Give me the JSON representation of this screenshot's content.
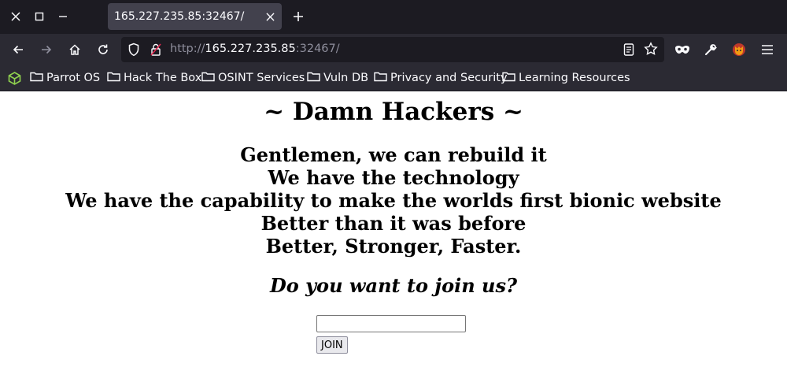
{
  "browser": {
    "tab": {
      "title": "165.227.235.85:32467/"
    },
    "url": {
      "scheme": "http://",
      "host": "165.227.235.85",
      "port": ":32467/"
    },
    "bookmarks": [
      {
        "label": "Parrot OS"
      },
      {
        "label": "Hack The Box"
      },
      {
        "label": "OSINT Services"
      },
      {
        "label": "Vuln DB"
      },
      {
        "label": "Privacy and Security"
      },
      {
        "label": "Learning Resources"
      }
    ]
  },
  "page": {
    "heading": "~ Damn Hackers ~",
    "lines": [
      "Gentlemen, we can rebuild it",
      "We have the technology",
      "We have the capability to make the worlds first bionic website",
      "Better than it was before",
      "Better, Stronger, Faster."
    ],
    "question": "Do you want to join us?",
    "join_input_value": "",
    "join_button": "JOIN"
  }
}
